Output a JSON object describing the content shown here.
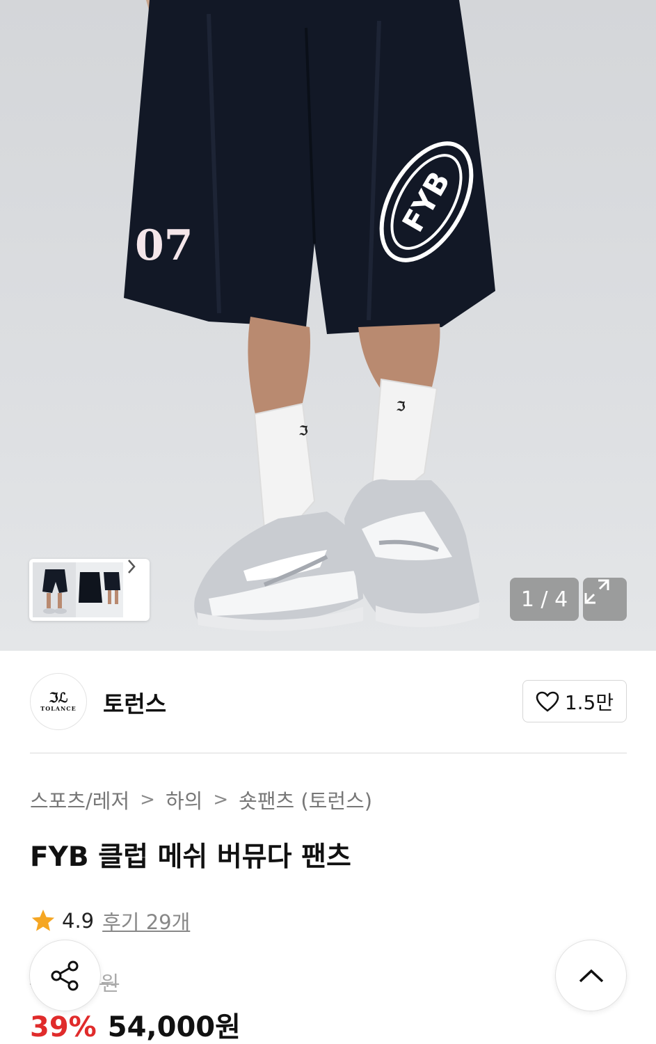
{
  "gallery": {
    "shorts_print_number": "07",
    "shorts_print_logo": "FYB",
    "counter": "1 / 4",
    "thumbnail_next_icon": "chevron-right-icon",
    "expand_icon": "expand-arrows-icon"
  },
  "brand": {
    "logo_monogram": "ℑℒ",
    "logo_word": "TOLANCE",
    "name": "토런스",
    "like_icon": "heart-outline-icon",
    "like_count": "1.5만"
  },
  "breadcrumb": {
    "items": [
      "스포츠/레저",
      "하의",
      "숏팬츠 (토런스)"
    ],
    "separator": ">"
  },
  "product": {
    "title": "FYB 클럽 메쉬 버뮤다 팬츠",
    "rating_icon": "star-icon",
    "rating": "4.9",
    "reviews": "후기 29개",
    "original_price": "89,000원",
    "discount": "39%",
    "price": "54,000원"
  },
  "floating": {
    "share_icon": "share-icon",
    "scroll_top_icon": "chevron-up-icon"
  },
  "colors": {
    "discount": "#e02b2b",
    "star": "#f5a623",
    "shorts": "#111827"
  }
}
